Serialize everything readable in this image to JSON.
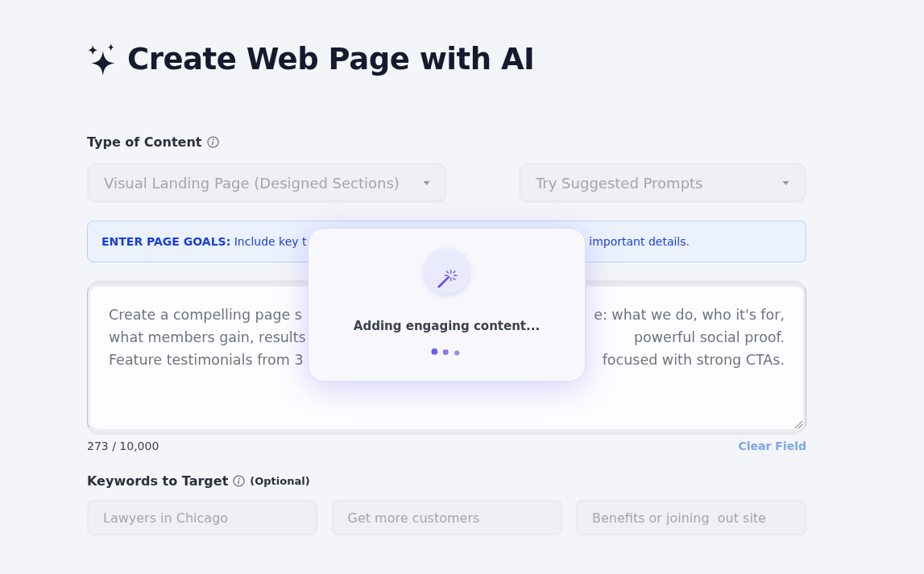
{
  "header": {
    "title": "Create Web Page with AI"
  },
  "content_type": {
    "label": "Type of Content",
    "dropdowns": [
      {
        "value": "Visual Landing Page (Designed Sections)",
        "disabled": true
      },
      {
        "value": "Try Suggested Prompts",
        "disabled": true
      }
    ]
  },
  "goals_banner": {
    "heading": "ENTER PAGE GOALS:",
    "text_left": "Include key t",
    "text_right": "important details."
  },
  "prompt_field": {
    "lines": [
      {
        "left": "Create a compelling page s",
        "right": "e: what we do, who it's for,"
      },
      {
        "left": "what members gain, results",
        "right": "powerful social proof."
      },
      {
        "left": "Feature testimonials from 3",
        "right": "focused with strong CTAs."
      }
    ],
    "char_count": "273 / 10,000",
    "clear_link": "Clear Field"
  },
  "loading_dialog": {
    "message": "Adding engaging content..."
  },
  "keywords": {
    "label": "Keywords to Target",
    "optional": "(Optional)",
    "fields": [
      {
        "placeholder": "Lawyers in Chicago"
      },
      {
        "placeholder": "Get more customers"
      },
      {
        "placeholder": "Benefits or joining  out site"
      }
    ]
  }
}
